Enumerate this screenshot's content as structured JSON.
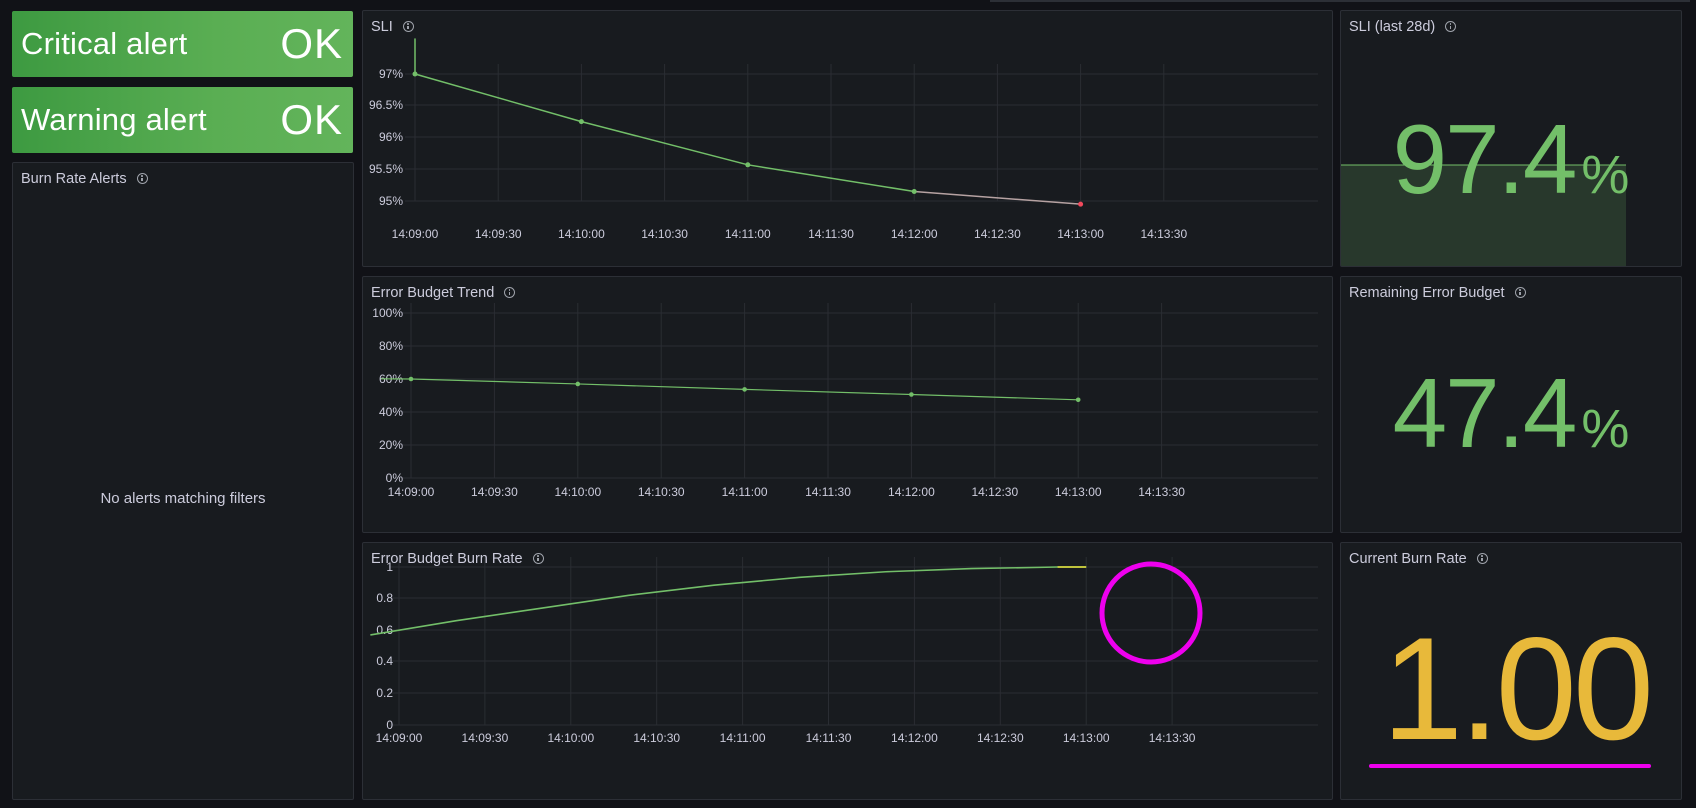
{
  "alerts": {
    "critical": {
      "label": "Critical alert",
      "state": "OK"
    },
    "warning": {
      "label": "Warning alert",
      "state": "OK"
    }
  },
  "burn_rate_alerts": {
    "title": "Burn Rate Alerts",
    "empty_message": "No alerts matching filters"
  },
  "sli_panel": {
    "title": "SLI"
  },
  "sli_stat": {
    "title": "SLI (last 28d)",
    "value": "97.4",
    "unit": "%",
    "color": "#73bf69"
  },
  "error_budget_trend": {
    "title": "Error Budget Trend"
  },
  "remaining_budget": {
    "title": "Remaining Error Budget",
    "value": "47.4",
    "unit": "%",
    "color": "#73bf69"
  },
  "burn_rate_panel": {
    "title": "Error Budget Burn Rate"
  },
  "current_burn_rate": {
    "title": "Current Burn Rate",
    "value": "1.00",
    "color": "#e8b93a"
  },
  "annotation_color": "#ee00ee",
  "chart_data": [
    {
      "type": "line",
      "title": "SLI",
      "x": [
        "14:09:00",
        "14:10:00",
        "14:11:00",
        "14:12:00",
        "14:13:00"
      ],
      "x_ticks": [
        "14:09:00",
        "14:09:30",
        "14:10:00",
        "14:10:30",
        "14:11:00",
        "14:11:30",
        "14:12:00",
        "14:12:30",
        "14:13:00",
        "14:13:30"
      ],
      "y_ticks": [
        "97%",
        "96.5%",
        "96%",
        "95.5%",
        "95%"
      ],
      "series": [
        {
          "values": [
            97.0,
            96.25,
            95.57,
            95.15,
            94.95
          ],
          "color": "#73bf69",
          "last_point_color": "#f2495c"
        }
      ],
      "ylim": [
        94.65,
        97.4
      ],
      "grid": true
    },
    {
      "type": "line",
      "title": "Error Budget Trend",
      "x": [
        "14:09:00",
        "14:10:00",
        "14:11:00",
        "14:12:00",
        "14:13:00"
      ],
      "x_ticks": [
        "14:09:00",
        "14:09:30",
        "14:10:00",
        "14:10:30",
        "14:11:00",
        "14:11:30",
        "14:12:00",
        "14:12:30",
        "14:13:00",
        "14:13:30"
      ],
      "y_ticks": [
        "100%",
        "80%",
        "60%",
        "40%",
        "20%",
        "0%"
      ],
      "series": [
        {
          "values": [
            60.0,
            57.0,
            53.7,
            50.6,
            47.4
          ],
          "color": "#73bf69"
        }
      ],
      "ylim": [
        0,
        100
      ],
      "grid": true
    },
    {
      "type": "line",
      "title": "Error Budget Burn Rate",
      "x": [
        "14:08:50",
        "14:09:20",
        "14:09:50",
        "14:10:20",
        "14:10:50",
        "14:11:20",
        "14:11:50",
        "14:12:20",
        "14:12:50",
        "14:13:00"
      ],
      "x_ticks": [
        "14:09:00",
        "14:09:30",
        "14:10:00",
        "14:10:30",
        "14:11:00",
        "14:11:30",
        "14:12:00",
        "14:12:30",
        "14:13:00",
        "14:13:30"
      ],
      "y_ticks": [
        "1",
        "0.8",
        "0.6",
        "0.4",
        "0.2",
        "0"
      ],
      "series": [
        {
          "values": [
            0.57,
            0.66,
            0.74,
            0.82,
            0.885,
            0.935,
            0.97,
            0.99,
            1.0,
            1.0
          ],
          "color": "#73bf69",
          "tail_color": "#e8e03a"
        }
      ],
      "ylim": [
        0,
        1.1
      ],
      "grid": true
    }
  ]
}
